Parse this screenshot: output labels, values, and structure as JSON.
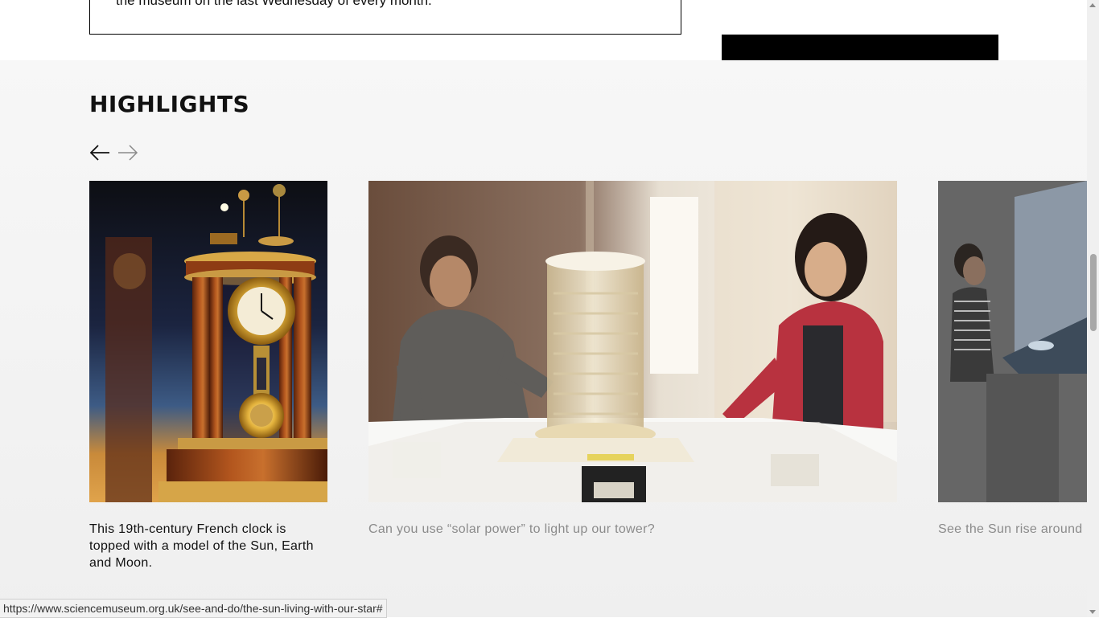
{
  "top": {
    "info_text": "the museum on the last Wednesday of every month."
  },
  "highlights": {
    "title": "HIGHLIGHTS",
    "prev_icon": "arrow-left-icon",
    "next_icon": "arrow-right-icon",
    "cards": [
      {
        "caption": "This 19th-century French clock is topped with a model of the Sun, Earth and Moon."
      },
      {
        "caption": "Can you use “solar power” to light up our tower?"
      },
      {
        "caption": "See the Sun rise around"
      }
    ]
  },
  "status_bar": {
    "url": "https://www.sciencemuseum.org.uk/see-and-do/the-sun-living-with-our-star#"
  },
  "colors": {
    "highlight_bg": "#f5f5f5",
    "active_caption": "#111111",
    "inactive_caption": "#8b8b8b"
  }
}
